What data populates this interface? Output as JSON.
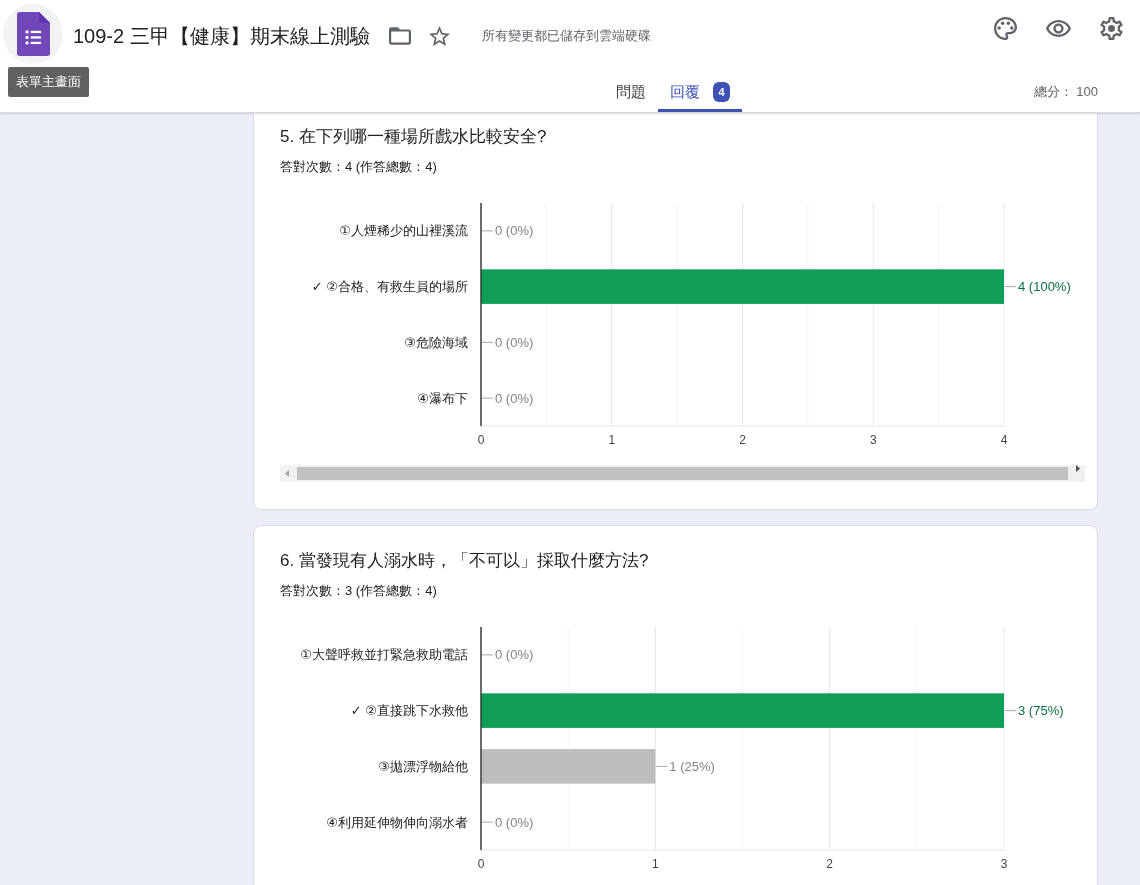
{
  "header": {
    "title": "109-2 三甲【健康】期末線上測驗",
    "save_status": "所有變更都已儲存到雲端硬碟",
    "home_tooltip": "表單主畫面"
  },
  "tabs": [
    {
      "label": "問題",
      "selected": false
    },
    {
      "label": "回覆",
      "selected": true,
      "badge": "4"
    }
  ],
  "total_points": "總分： 100",
  "questions": [
    {
      "title": "5. 在下列哪一種場所戲水比較安全?",
      "summary": "答對次數：4 (作答總數：4)",
      "horizontal_scrollbar": true,
      "chart_data": {
        "type": "bar",
        "orientation": "horizontal",
        "stacked": true,
        "grid": true,
        "categories": [
          "①人煙稀少的山裡溪流",
          "✓ ②合格、有救生員的場所",
          "③危險海域",
          "④瀑布下"
        ],
        "series": [
          {
            "color": "#0f9d58",
            "values": [
              null,
              4,
              null,
              null
            ]
          },
          {
            "color": "#bdbdbd",
            "values": [
              0,
              null,
              0,
              0
            ]
          }
        ],
        "xlim": [
          0,
          4
        ],
        "xticks": [
          0,
          1,
          2,
          3,
          4
        ],
        "value_labels": [
          "0 (0%)",
          "4 (100%)",
          "0 (0%)",
          "0 (0%)"
        ]
      }
    },
    {
      "title": "6. 當發現有人溺水時，「不可以」採取什麼方法?",
      "summary": "答對次數：3 (作答總數：4)",
      "horizontal_scrollbar": false,
      "chart_data": {
        "type": "bar",
        "orientation": "horizontal",
        "stacked": true,
        "grid": true,
        "categories": [
          "①大聲呼救並打緊急救助電話",
          "✓ ②直接跳下水救他",
          "③拋漂浮物給他",
          "④利用延伸物伸向溺水者"
        ],
        "series": [
          {
            "color": "#0f9d58",
            "values": [
              null,
              3,
              null,
              null
            ]
          },
          {
            "color": "#bdbdbd",
            "values": [
              0,
              null,
              1,
              0
            ]
          }
        ],
        "xlim": [
          0,
          3
        ],
        "xticks": [
          0,
          1,
          2,
          3
        ],
        "value_labels": [
          "0 (0%)",
          "3 (75%)",
          "1 (25%)",
          "0 (0%)"
        ]
      }
    }
  ]
}
